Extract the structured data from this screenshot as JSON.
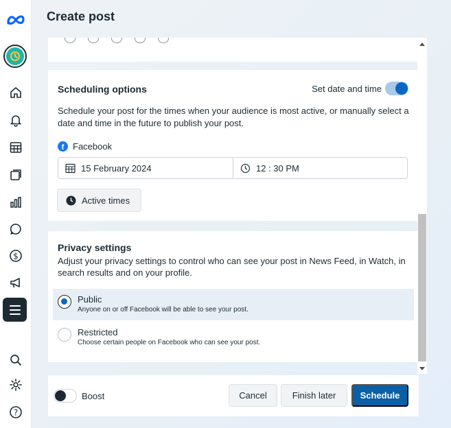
{
  "page": {
    "title": "Create post"
  },
  "scheduling": {
    "heading": "Scheduling options",
    "toggle_label": "Set date and time",
    "toggle_on": true,
    "description_line1": "Schedule your post for the times when your audience is most active, or manually select a",
    "description_line2": "date and time in the future to publish your post.",
    "platform": "Facebook",
    "date": "15 February 2024",
    "time": "12 : 30 PM",
    "active_times_label": "Active times"
  },
  "privacy": {
    "heading": "Privacy settings",
    "description_line1": "Adjust your privacy settings to control who can see your post in News Feed, in Watch, in",
    "description_line2": "search results and on your profile.",
    "options": [
      {
        "title": "Public",
        "subtitle": "Anyone on or off Facebook will be able to see your post.",
        "selected": true
      },
      {
        "title": "Restricted",
        "subtitle": "Choose certain people on Facebook who can see your post.",
        "selected": false
      }
    ]
  },
  "footer": {
    "boost_label": "Boost",
    "boost_on": false,
    "cancel_label": "Cancel",
    "finish_later_label": "Finish later",
    "schedule_label": "Schedule"
  },
  "sidebar": {
    "icons": [
      "meta-logo-icon",
      "account-avatar",
      "home-icon",
      "notifications-bell-icon",
      "content-calendar-icon",
      "content-library-icon",
      "insights-bar-chart-icon",
      "inbox-chat-icon",
      "monetization-dollar-icon",
      "ads-megaphone-icon",
      "all-tools-menu-icon",
      "search-icon",
      "settings-gear-icon",
      "help-icon"
    ]
  },
  "colors": {
    "accent": "#0a66c2",
    "primary_button": "#0b5fa5",
    "dark": "#1c2b33",
    "facebook_blue": "#1877f2"
  }
}
